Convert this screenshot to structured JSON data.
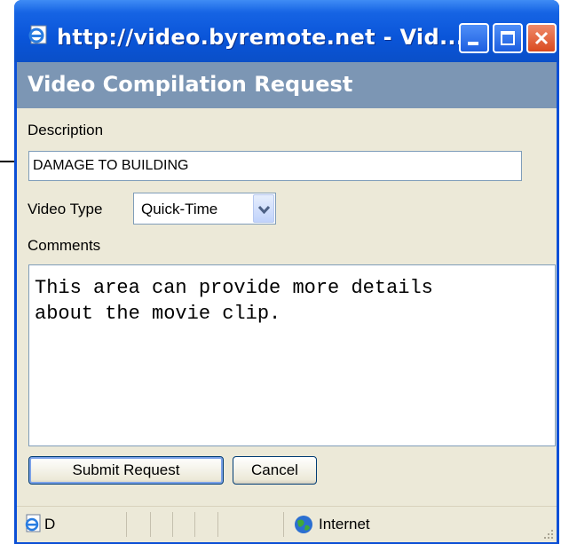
{
  "window": {
    "title": "http://video.byremote.net - Vid...",
    "colors": {
      "titlebar": "#0a55d9",
      "header": "#7c96b4",
      "body": "#ece9d8"
    },
    "icons": {
      "app": "ie-page-icon",
      "minimize": "minimize-icon",
      "maximize": "maximize-icon",
      "close": "close-icon"
    }
  },
  "form": {
    "heading": "Video Compilation Request",
    "description_label": "Description",
    "description_value": "DAMAGE TO BUILDING",
    "video_type_label": "Video Type",
    "video_type_value": "Quick-Time",
    "comments_label": "Comments",
    "comments_value": "This area can provide more details\nabout the movie clip.",
    "submit_label": "Submit Request",
    "cancel_label": "Cancel"
  },
  "statusbar": {
    "status_text": "D",
    "zone_text": "Internet",
    "icons": {
      "page": "ie-page-icon",
      "zone": "globe-icon",
      "resize": "resize-grip-icon"
    }
  }
}
